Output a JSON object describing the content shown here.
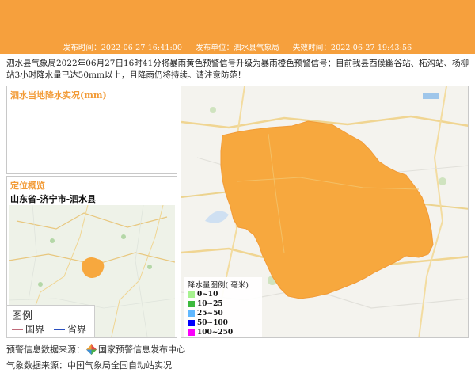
{
  "header": {
    "publish_time": "发布时间：2022-06-27 16:41:00",
    "publisher": "发布单位：泗水县气象局",
    "expire_time": "失效时间：2022-06-27 19:43:56"
  },
  "description": "泗水县气象局2022年06月27日16时41分将暴雨黄色预警信号升级为暴雨橙色预警信号：目前我县西侯幽谷站、柘沟站、杨柳站3小时降水量已达50mm以上，且降雨仍将持续。请注意防范！",
  "rain_panel": {
    "title": "泗水当地降水实况(mm)"
  },
  "location_panel": {
    "title": "定位概览",
    "location": "山东省-济宁市-泗水县"
  },
  "map_legend": {
    "title": "图例",
    "items": [
      {
        "label": "国界",
        "color": "#c06a7a"
      },
      {
        "label": "省界",
        "color": "#2a4fbf"
      }
    ]
  },
  "rain_legend": {
    "title": "降水量图例( 毫米)",
    "items": [
      {
        "label": "0~10",
        "color": "#a6f28f"
      },
      {
        "label": "10~25",
        "color": "#3dba3d"
      },
      {
        "label": "25~50",
        "color": "#61b8ff"
      },
      {
        "label": "50~100",
        "color": "#0000fe"
      },
      {
        "label": "100~250",
        "color": "#fa00fa"
      }
    ]
  },
  "sources": {
    "warning_prefix": "预警信息数据来源：",
    "warning_name": "国家预警信息发布中心",
    "weather": "气象数据来源：中国气象局全国自动站实况"
  },
  "colors": {
    "accent": "#f6a03d",
    "title": "#f29b37",
    "county_fill": "#f7a83e"
  }
}
